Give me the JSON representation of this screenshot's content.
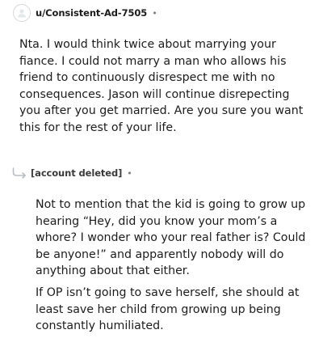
{
  "comments": [
    {
      "username": "u/Consistent-Ad-7505",
      "separator": "•",
      "body": "Nta. I would think twice about marrying your fiance. I could not marry a man who allows his friend to continuously disrespect me with no consequences. Jason will continue disrepecting you after you get married. Are you sure you want this for the rest of your life."
    },
    {
      "username": "[account deleted]",
      "separator": "•",
      "paragraphs": [
        "Not to mention that the kid is going to grow up hearing “Hey, did you know your mom’s a whore? I wonder who your real father is? Could be anyone!” and apparently nobody will do anything about that either.",
        "If OP isn’t going to save herself, she should at least save her child from growing up being constantly humiliated."
      ]
    }
  ],
  "icons": {
    "avatar": "user-avatar-icon",
    "reply": "reply-arrow-icon"
  },
  "colors": {
    "text": "#1c1c1c",
    "muted": "#7c7c7c",
    "avatar_border": "#d4d7d9",
    "reply_arrow": "#b8bdc1"
  }
}
